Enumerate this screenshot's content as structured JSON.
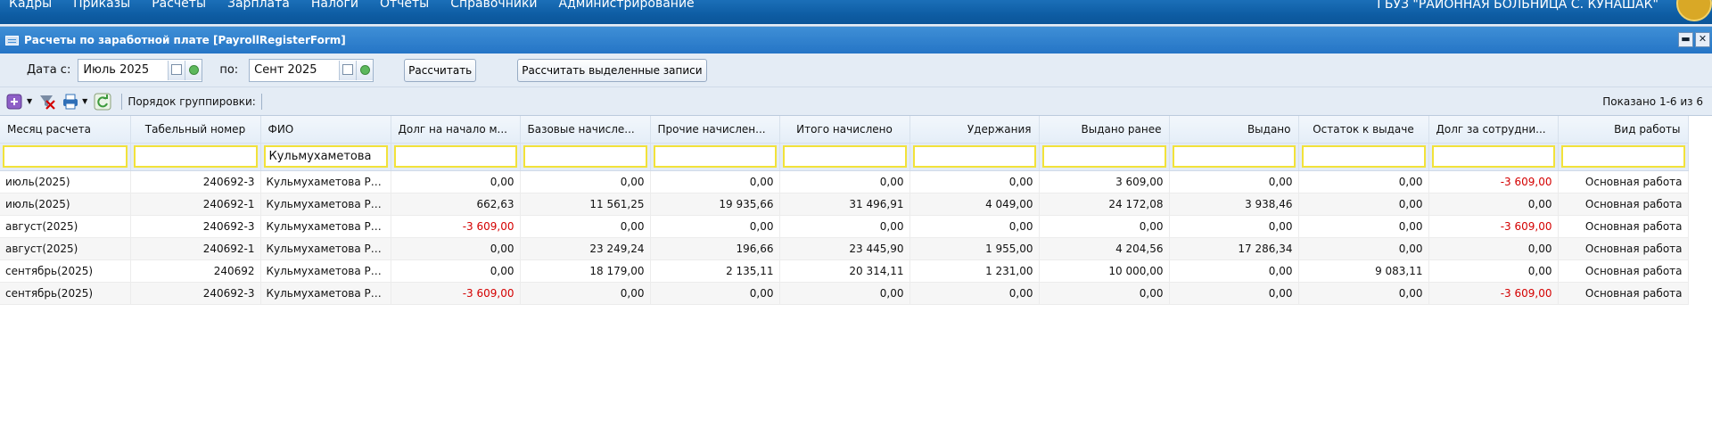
{
  "top_menu": [
    "Кадры",
    "Приказы",
    "Расчеты",
    "Зарплата",
    "Налоги",
    "Отчеты",
    "Справочники",
    "Администрирование"
  ],
  "org_name": "ГБУЗ \"РАЙОННАЯ БОЛЬНИЦА С. КУНАШАК\"",
  "window": {
    "title": "Расчеты по заработной плате [PayrollRegisterForm]",
    "minimize_glyph": "▬",
    "close_glyph": "✕"
  },
  "filters": {
    "date_from_label": "Дата с:",
    "date_from_value": "Июль 2025",
    "date_to_label": "по:",
    "date_to_value": "Сент 2025",
    "calc_button": "Рассчитать",
    "calc_selected_button": "Рассчитать выделенные записи"
  },
  "toolbar": {
    "grouping_label": "Порядок группировки:",
    "shown_text": "Показано 1-6 из 6",
    "icons": [
      "add-icon",
      "clear-filter-icon",
      "print-icon",
      "refresh-icon"
    ]
  },
  "columns": [
    {
      "label": "Месяц расчета",
      "align": "l"
    },
    {
      "label": "Табельный номер",
      "align": "c"
    },
    {
      "label": "ФИО",
      "align": "l"
    },
    {
      "label": "Долг на начало м...",
      "align": "l"
    },
    {
      "label": "Базовые начисле...",
      "align": "l"
    },
    {
      "label": "Прочие начислен...",
      "align": "l"
    },
    {
      "label": "Итого начислено",
      "align": "c"
    },
    {
      "label": "Удержания",
      "align": "r"
    },
    {
      "label": "Выдано ранее",
      "align": "r"
    },
    {
      "label": "Выдано",
      "align": "r"
    },
    {
      "label": "Остаток к выдаче",
      "align": "c"
    },
    {
      "label": "Долг за сотрудни...",
      "align": "l"
    },
    {
      "label": "Вид работы",
      "align": "r"
    }
  ],
  "filter_values": [
    "",
    "",
    "Кульмухаметова",
    "",
    "",
    "",
    "",
    "",
    "",
    "",
    "",
    "",
    ""
  ],
  "rows": [
    [
      "июль(2025)",
      "240692-3",
      "Кульмухаметова Ро...",
      "0,00",
      "0,00",
      "0,00",
      "0,00",
      "0,00",
      "3 609,00",
      "0,00",
      "0,00",
      "-3 609,00",
      "Основная работа"
    ],
    [
      "июль(2025)",
      "240692-1",
      "Кульмухаметова Ро...",
      "662,63",
      "11 561,25",
      "19 935,66",
      "31 496,91",
      "4 049,00",
      "24 172,08",
      "3 938,46",
      "0,00",
      "0,00",
      "Основная работа"
    ],
    [
      "август(2025)",
      "240692-3",
      "Кульмухаметова Ро...",
      "-3 609,00",
      "0,00",
      "0,00",
      "0,00",
      "0,00",
      "0,00",
      "0,00",
      "0,00",
      "-3 609,00",
      "Основная работа"
    ],
    [
      "август(2025)",
      "240692-1",
      "Кульмухаметова Ро...",
      "0,00",
      "23 249,24",
      "196,66",
      "23 445,90",
      "1 955,00",
      "4 204,56",
      "17 286,34",
      "0,00",
      "0,00",
      "Основная работа"
    ],
    [
      "сентябрь(2025)",
      "240692",
      "Кульмухаметова Ро...",
      "0,00",
      "18 179,00",
      "2 135,11",
      "20 314,11",
      "1 231,00",
      "10 000,00",
      "0,00",
      "9 083,11",
      "0,00",
      "Основная работа"
    ],
    [
      "сентябрь(2025)",
      "240692-3",
      "Кульмухаметова Ро...",
      "-3 609,00",
      "0,00",
      "0,00",
      "0,00",
      "0,00",
      "0,00",
      "0,00",
      "0,00",
      "-3 609,00",
      "Основная работа"
    ]
  ],
  "colors": {
    "accent": "#1b6fb8",
    "negative": "#d40000",
    "filter_border": "#f2e23a"
  }
}
